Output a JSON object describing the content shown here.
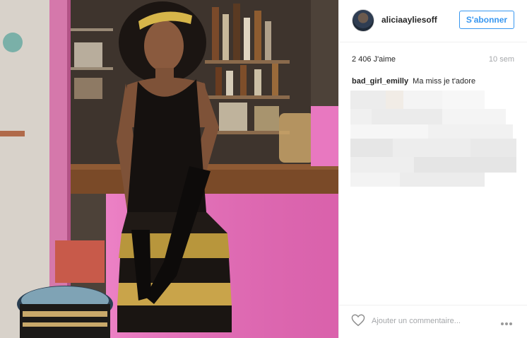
{
  "post": {
    "username": "aliciaayliesoff",
    "follow_label": "S'abonner",
    "likes": "2 406 J'aime",
    "time_ago": "10 sem",
    "add_comment_placeholder": "Ajouter un commentaire...",
    "photo_subject": "woman in black flapper dress with gold fringe, gold headband and long black gloves, standing in front of a bar with a pink counter"
  },
  "comments": [
    {
      "user": "bad_girl_emilly",
      "text": "Ma miss je t'adore"
    }
  ],
  "icons": {
    "like": "heart-outline-icon",
    "more": "more-options-icon"
  },
  "colors": {
    "accent": "#3897f0",
    "text": "#262626",
    "muted": "#a5a7aa",
    "divider": "#efefef",
    "bar_pink": "#e36cb5"
  }
}
